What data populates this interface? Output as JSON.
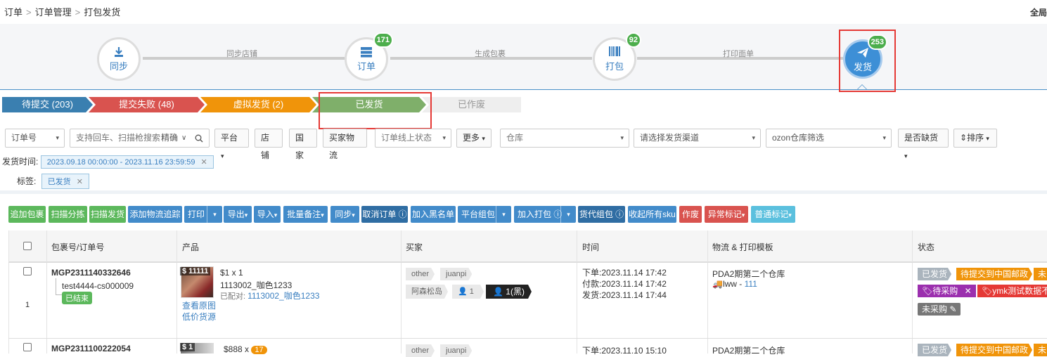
{
  "breadcrumb": {
    "items": [
      "订单",
      "订单管理",
      "打包发货"
    ]
  },
  "fullscreen_label": "全局",
  "flow": {
    "steps": [
      {
        "label": "同步",
        "icon": "download-icon",
        "badge": ""
      },
      {
        "label": "订单",
        "icon": "list-icon",
        "badge": "171"
      },
      {
        "label": "打包",
        "icon": "barcode-icon",
        "badge": "92"
      },
      {
        "label": "发货",
        "icon": "paper-plane-icon",
        "badge": "253"
      }
    ],
    "connectors": [
      "同步店铺",
      "生成包裹",
      "打印面单"
    ]
  },
  "status_tabs": [
    {
      "label": "待提交 (203)",
      "color": "#3a7fb0"
    },
    {
      "label": "提交失败 (48)",
      "color": "#d9534f"
    },
    {
      "label": "虚拟发货 (2)",
      "color": "#f0940a"
    },
    {
      "label": "已发货",
      "color": "#7faf6a"
    },
    {
      "label": "已作废",
      "color": "#eeeeee"
    }
  ],
  "filters": {
    "order_no": "订单号",
    "search_placeholder": "支持回车、扫描枪搜索",
    "search_mode": "精确",
    "platform": "平台",
    "shop": "店铺",
    "country": "国家",
    "buyer_logistics": "买家物流",
    "online_status": "订单线上状态",
    "more": "更多",
    "warehouse": "仓库",
    "channel": "请选择发货渠道",
    "ozon": "ozon仓库筛选",
    "stockout": "是否缺货",
    "sort": "排序"
  },
  "ship_time": {
    "label": "发货时间:",
    "value": "2023.09.18 00:00:00 - 2023.11.16 23:59:59"
  },
  "tag_filter": {
    "label": "标签:",
    "value": "已发货"
  },
  "toolbar": [
    "追加包裹",
    "扫描分拣",
    "扫描发货",
    "添加物流追踪",
    "打印",
    "导出",
    "导入",
    "批量备注",
    "同步",
    "取消订单",
    "加入黑名单",
    "平台组包",
    "加入打包",
    "货代组包",
    "收起所有sku",
    "作废",
    "异常标记",
    "普通标记"
  ],
  "table": {
    "headers": [
      "包裹号/订单号",
      "产品",
      "买家",
      "时间",
      "物流 & 打印模板",
      "状态"
    ],
    "rows": [
      {
        "index": "1",
        "package_no": "MGP2311140332646",
        "order_no": "test4444-cs000009",
        "order_status": "已结束",
        "price_badge": "$ 11111",
        "qty": "$1 x 1",
        "sku": "1113002_咖色1233",
        "matched_label": "已配对:",
        "matched_sku": "1113002_咖色1233",
        "view_image": "查看原图",
        "low_price": "低价货源",
        "buyer_tags": [
          "other",
          "juanpi"
        ],
        "buyer_name": "阿森松岛",
        "buyer_count": "1",
        "buyer_black": "1(黑)",
        "times": [
          "下单:2023.11.14 17:42",
          "付款:2023.11.14 17:42",
          "发货:2023.11.14 17:44"
        ],
        "warehouse": "PDA2期第二个仓库",
        "logistics": "lww - ",
        "logistics_code": "111",
        "status_tags": [
          "已发货",
          "待提交到中国邮政",
          "未"
        ],
        "status_tags2": [
          "待采购",
          "ymk测试数据不..."
        ],
        "purchase": "未采购"
      },
      {
        "package_no": "MGP2311100222054",
        "price_badge": "$ 1",
        "qty": "$888 x",
        "qty_badge": "17",
        "buyer_tags": [
          "other",
          "juanpi"
        ],
        "time": "下单:2023.11.10 15:10",
        "warehouse": "PDA2期第二个仓库",
        "status_tags": [
          "已发货",
          "待提交到中国邮政",
          "未"
        ]
      }
    ]
  }
}
